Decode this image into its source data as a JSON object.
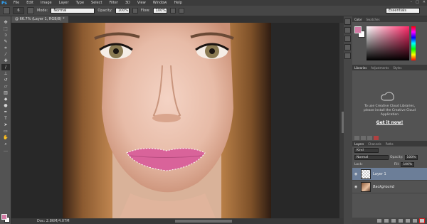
{
  "app": {
    "logo": "Ps"
  },
  "menu": [
    "File",
    "Edit",
    "Image",
    "Layer",
    "Type",
    "Select",
    "Filter",
    "3D",
    "View",
    "Window",
    "Help"
  ],
  "window_controls": [
    "–",
    "□",
    "✕"
  ],
  "options": {
    "brush_size": "6",
    "mode_label": "Mode:",
    "mode_value": "Normal",
    "opacity_label": "Opacity:",
    "opacity_value": "100%",
    "flow_label": "Flow:",
    "flow_value": "100%",
    "workspace": "Essentials"
  },
  "document": {
    "tab_title": "@ 66.7% (Layer 1, RGB/8) *",
    "status": "Doc: 2.86M/4.07M"
  },
  "colors": {
    "foreground": "#d47aa5",
    "background": "#ffffff",
    "lip_paint": "#d9639a"
  },
  "color_panel": {
    "tabs": [
      "Color",
      "Swatches"
    ]
  },
  "libraries": {
    "tabs": [
      "Libraries",
      "Adjustments",
      "Styles"
    ],
    "message": "To use Creative Cloud Libraries, please install the Creative Cloud Application",
    "link": "Get it now!"
  },
  "layers": {
    "tabs": [
      "Layers",
      "Channels",
      "Paths"
    ],
    "kind": "Kind",
    "blend_mode": "Normal",
    "opacity_label": "Opacity:",
    "opacity_value": "100%",
    "lock_label": "Lock:",
    "fill_label": "Fill:",
    "fill_value": "100%",
    "items": [
      {
        "name": "Layer 1",
        "selected": true
      },
      {
        "name": "Background",
        "selected": false
      }
    ]
  }
}
